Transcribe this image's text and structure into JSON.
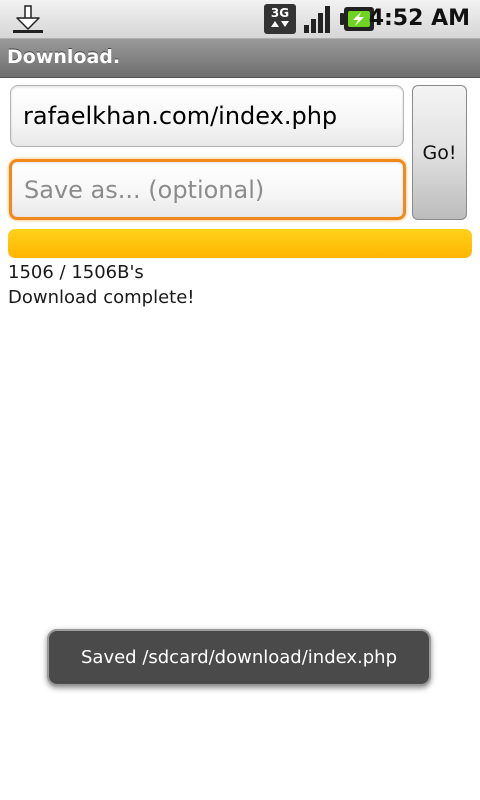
{
  "status_bar": {
    "time": "4:52 AM",
    "network_label": "3G",
    "icons": [
      "download-notification-icon",
      "3g-data-icon",
      "signal-strength-icon",
      "battery-charging-icon"
    ]
  },
  "app": {
    "title": "Download."
  },
  "form": {
    "url_value": "rafaelkhan.com/index.php",
    "saveas_value": "",
    "saveas_placeholder": "Save as... (optional)",
    "go_label": "Go!"
  },
  "progress": {
    "fraction": 1.0,
    "bytes_text": "1506 / 1506B's",
    "status_text": "Download complete!"
  },
  "toast": {
    "message": "Saved /sdcard/download/index.php"
  },
  "colors": {
    "progress_fill": "#ffb400",
    "focus_border": "#f08a1c"
  }
}
